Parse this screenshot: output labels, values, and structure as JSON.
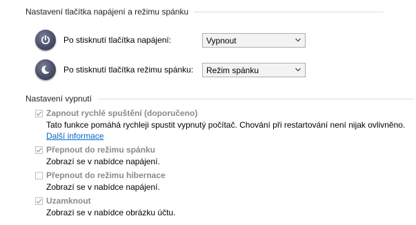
{
  "power_section": {
    "header": "Nastavení tlačítka napájení a režimu spánku",
    "power_button": {
      "label": "Po stisknutí tlačítka napájení:",
      "value": "Vypnout",
      "icon": "power-icon"
    },
    "sleep_button": {
      "label": "Po stisknutí tlačítka režimu spánku:",
      "value": "Režim spánku",
      "icon": "sleep-moon-icon"
    }
  },
  "shutdown_section": {
    "header": "Nastavení vypnutí",
    "items": [
      {
        "title": "Zapnout rychlé spuštění (doporučeno)",
        "description": "Tato funkce pomáhá rychleji spustit vypnutý počítač. Chování při restartování není nijak ovlivněno.",
        "link": "Další informace",
        "checked": true,
        "disabled": true
      },
      {
        "title": "Přepnout do režimu spánku",
        "description": "Zobrazí se v nabídce napájení.",
        "checked": true,
        "disabled": true
      },
      {
        "title": "Přepnout do režimu hibernace",
        "description": "Zobrazí se v nabídce napájení.",
        "checked": false,
        "disabled": true
      },
      {
        "title": "Uzamknout",
        "description": "Zobrazí se v nabídce obrázku účtu.",
        "checked": true,
        "disabled": true
      }
    ]
  },
  "colors": {
    "disabled_text": "#8a8a8a",
    "link": "#0066cc",
    "divider": "#dcdcdc"
  }
}
